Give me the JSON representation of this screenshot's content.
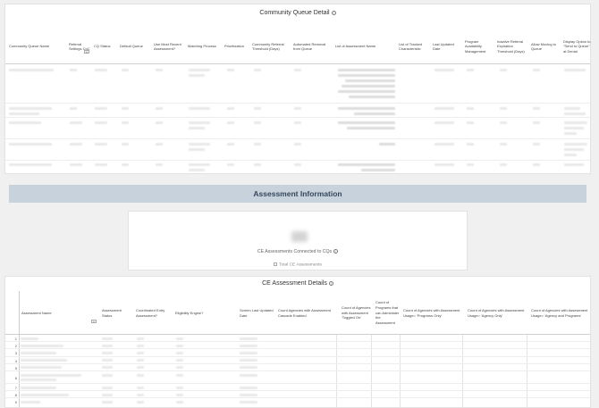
{
  "community_queue": {
    "title": "Community Queue Detail",
    "columns": [
      "Community Queue Name",
      "Referral Settings CoC",
      "CQ Status",
      "Default Queue",
      "Use Most Recent Assessment?",
      "Matching Process",
      "Prioritization",
      "Community Referral Threshold (Days)",
      "Automated Removal from Queue",
      "List of Assessment Name",
      "List of Tracked Characteristic",
      "Last Updated Date",
      "Program Availability Management",
      "Inactive Referral Expiration Threshold (Days)",
      "Allow Moving to Queue",
      "Display Option to \"Send to Queue\" at Denial"
    ],
    "collapse_label": "«"
  },
  "assessment_section": {
    "title": "Assessment Information"
  },
  "kpi": {
    "label": "CE Assessments Connected to CQs",
    "toggle_label": "Total CE Assessments"
  },
  "assessment_details": {
    "title": "CE Assessment Details",
    "collapse_label": "«",
    "columns": [
      "Assessment Name",
      "Assessment Status",
      "Coordinated Entry Assessment?",
      "Eligibility Engine?",
      "Screen Last Updated Date",
      "Count Agencies with Assessment Cascade Enabled",
      "Count of Agencies with Assessment 'Toggled On'",
      "Count of Programs that can Administer the Assessment",
      "Count of Agencies with Assessment Usage= 'Programs Only'",
      "Count of Agencies with Assessment Usage= 'Agency Only'",
      "Count of Agencies with Assessment Usage= 'Agency and Programs'"
    ],
    "row_numbers": [
      "1",
      "2",
      "3",
      "4",
      "5",
      "6",
      "7",
      "8",
      "9"
    ]
  }
}
